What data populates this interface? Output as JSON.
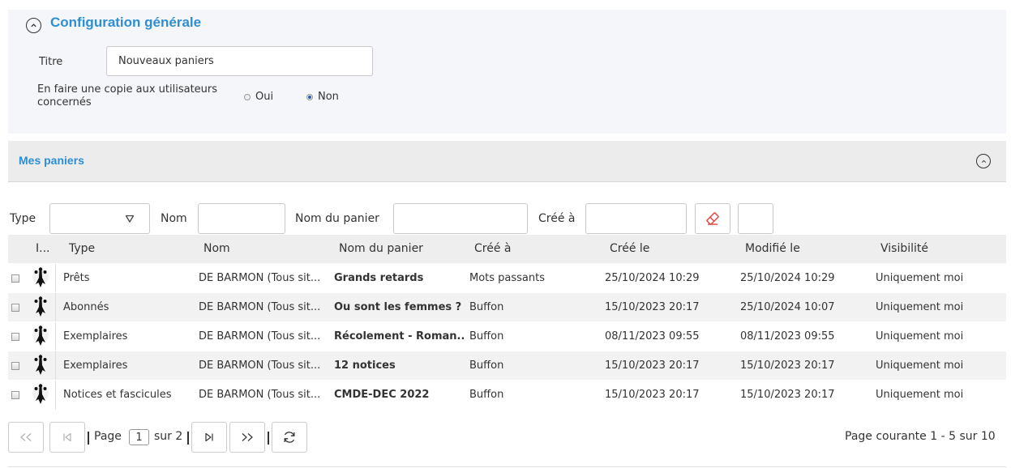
{
  "config": {
    "title": "Configuration générale",
    "titre_label": "Titre",
    "titre_value": "Nouveaux paniers",
    "copy_label_line1": "En faire une copie aux utilisateurs",
    "copy_label_line2": "concernés",
    "radio_oui": "Oui",
    "radio_non": "Non",
    "selected": "Non"
  },
  "paniers": {
    "title": "Mes paniers"
  },
  "filters": {
    "type_label": "Type",
    "nom_label": "Nom",
    "nom_panier_label": "Nom du panier",
    "cree_a_label": "Créé à"
  },
  "table": {
    "columns": [
      "I...",
      "Type",
      "Nom",
      "Nom du panier",
      "Créé à",
      "Créé le",
      "Modifié le",
      "Visibilité"
    ],
    "rows": [
      {
        "type": "Prêts",
        "nom": "DE BARMON (Tous sit...",
        "panier": "Grands retards",
        "cree_a": "Mots passants",
        "cree_le": "25/10/2024 10:29",
        "modifie_le": "25/10/2024 10:29",
        "visibilite": "Uniquement moi"
      },
      {
        "type": "Abonnés",
        "nom": "DE BARMON (Tous sit...",
        "panier": "Ou sont les femmes ?",
        "cree_a": "Buffon",
        "cree_le": "15/10/2023 20:17",
        "modifie_le": "25/10/2024 10:07",
        "visibilite": "Uniquement moi"
      },
      {
        "type": "Exemplaires",
        "nom": "DE BARMON (Tous sit...",
        "panier": "Récolement - Roman...",
        "cree_a": "Buffon",
        "cree_le": "08/11/2023 09:55",
        "modifie_le": "08/11/2023 09:55",
        "visibilite": "Uniquement moi"
      },
      {
        "type": "Exemplaires",
        "nom": "DE BARMON (Tous sit...",
        "panier": "12 notices",
        "cree_a": "Buffon",
        "cree_le": "15/10/2023 20:17",
        "modifie_le": "15/10/2023 20:17",
        "visibilite": "Uniquement moi"
      },
      {
        "type": "Notices et fascicules",
        "nom": "DE BARMON (Tous sit...",
        "panier": "CMDE-DEC 2022",
        "cree_a": "Buffon",
        "cree_le": "15/10/2023 20:17",
        "modifie_le": "15/10/2023 20:17",
        "visibilite": "Uniquement moi"
      }
    ]
  },
  "pagination": {
    "page_label": "Page",
    "page_value": "1",
    "sur_label": "sur 2",
    "summary": "Page courante 1 - 5 sur 10"
  },
  "icons": {
    "collapse": "chevron-up-circle-icon",
    "dropdown": "triangle-down-icon",
    "clear_filter": "eraser-icon",
    "first": "double-chevron-left-icon",
    "prev": "chevron-left-bar-icon",
    "next": "chevron-right-bar-icon",
    "last": "double-chevron-right-icon",
    "refresh": "refresh-icon",
    "avatar": "ermine-icon"
  },
  "colors": {
    "accent": "#2d8ed4",
    "eraser": "#e0413a"
  }
}
